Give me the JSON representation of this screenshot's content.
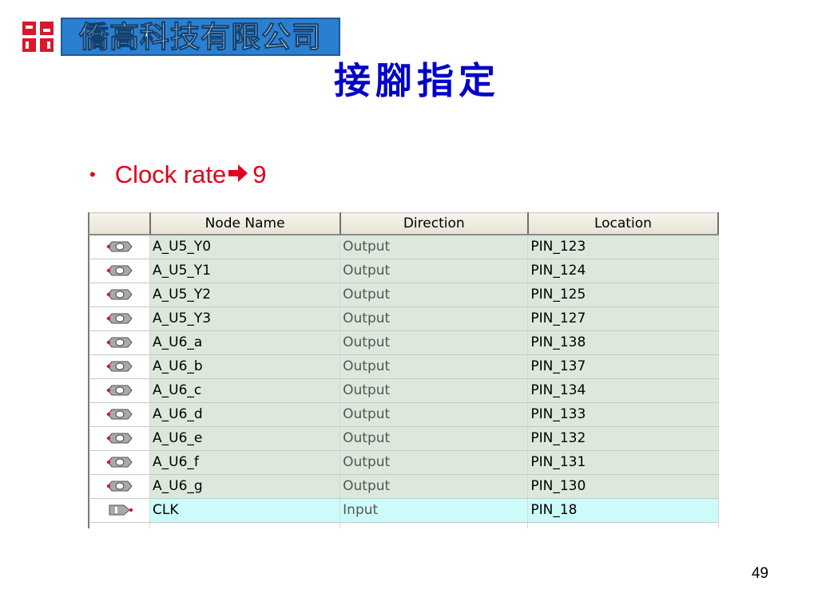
{
  "logo": {
    "text": "僑高科技有限公司"
  },
  "title": "接腳指定",
  "bullet": {
    "text_before": "Clock rate",
    "arrow_icon": "right-arrow-icon",
    "text_after": "9",
    "color": "#e0001b"
  },
  "table": {
    "headers": [
      "Node Name",
      "Direction",
      "Location"
    ],
    "rows": [
      {
        "icon": "output-pin-icon",
        "name": "A_U5_Y0",
        "direction": "Output",
        "location": "PIN_123"
      },
      {
        "icon": "output-pin-icon",
        "name": "A_U5_Y1",
        "direction": "Output",
        "location": "PIN_124"
      },
      {
        "icon": "output-pin-icon",
        "name": "A_U5_Y2",
        "direction": "Output",
        "location": "PIN_125"
      },
      {
        "icon": "output-pin-icon",
        "name": "A_U5_Y3",
        "direction": "Output",
        "location": "PIN_127"
      },
      {
        "icon": "output-pin-icon",
        "name": "A_U6_a",
        "direction": "Output",
        "location": "PIN_138"
      },
      {
        "icon": "output-pin-icon",
        "name": "A_U6_b",
        "direction": "Output",
        "location": "PIN_137"
      },
      {
        "icon": "output-pin-icon",
        "name": "A_U6_c",
        "direction": "Output",
        "location": "PIN_134"
      },
      {
        "icon": "output-pin-icon",
        "name": "A_U6_d",
        "direction": "Output",
        "location": "PIN_133"
      },
      {
        "icon": "output-pin-icon",
        "name": "A_U6_e",
        "direction": "Output",
        "location": "PIN_132"
      },
      {
        "icon": "output-pin-icon",
        "name": "A_U6_f",
        "direction": "Output",
        "location": "PIN_131"
      },
      {
        "icon": "output-pin-icon",
        "name": "A_U6_g",
        "direction": "Output",
        "location": "PIN_130"
      },
      {
        "icon": "input-pin-icon",
        "name": "CLK",
        "direction": "Input",
        "location": "PIN_18"
      }
    ],
    "colors": {
      "output_row": "#dde8dd",
      "input_row": "#ccfbfb"
    }
  },
  "page_number": "49"
}
